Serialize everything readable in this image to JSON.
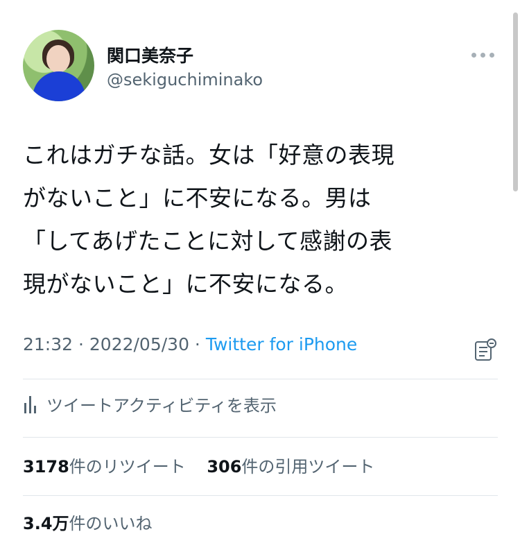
{
  "user": {
    "name": "関口美奈子",
    "handle": "@sekiguchiminako"
  },
  "tweet": {
    "lines": [
      "これはガチな話。女は「好意の表現",
      "がないこと」に不安になる。男は",
      "「してあげたことに対して感謝の表",
      "現がないこと」に不安になる。"
    ],
    "time": "21:32",
    "date": "2022/05/30",
    "separator": " · ",
    "source": "Twitter for iPhone"
  },
  "activity": {
    "label": "ツイートアクティビティを表示"
  },
  "stats": {
    "retweets_count": "3178",
    "retweets_label": "件のリツイート",
    "quotes_count": "306",
    "quotes_label": "件の引用ツイート",
    "likes_count": "3.4万",
    "likes_label": "件のいいね"
  },
  "colors": {
    "link": "#1d9bf0",
    "muted": "#536471",
    "text": "#0f1419"
  },
  "icons": {
    "more": "more-horizontal-icon",
    "analytics": "analytics-icon",
    "activity": "bar-chart-icon"
  }
}
